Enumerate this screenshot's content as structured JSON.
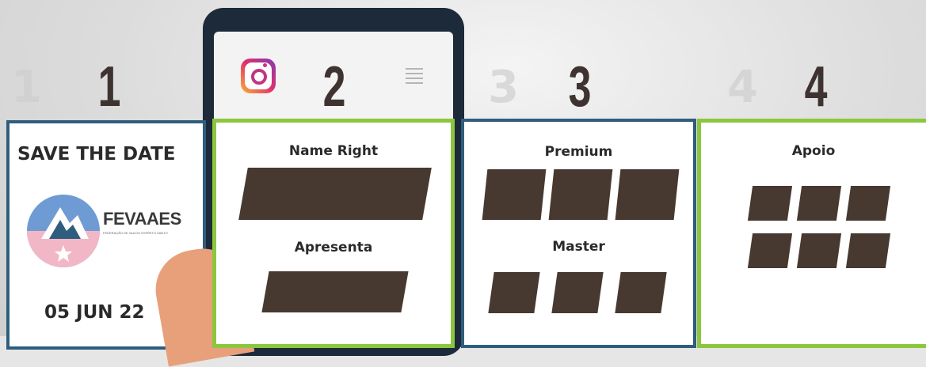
{
  "steps": {
    "one": "1",
    "two": "2",
    "three": "3",
    "four": "4"
  },
  "card1": {
    "title": "SAVE THE DATE",
    "logo_name": "FEVAAES",
    "logo_subtitle": "FEDERAÇÃO DE VAA DO ESPÍRITO SANTO",
    "date": "05 JUN 22"
  },
  "card2": {
    "label_top": "Name Right",
    "label_bottom": "Apresenta"
  },
  "card3": {
    "label_top": "Premium",
    "label_bottom": "Master"
  },
  "card4": {
    "label_top": "Apoio"
  },
  "colors": {
    "green_border": "#8cc63f",
    "blue_border": "#2f5d7e",
    "block": "#47392f",
    "number": "#3e3330"
  },
  "icons": [
    "instagram-icon",
    "hamburger-menu-icon"
  ]
}
